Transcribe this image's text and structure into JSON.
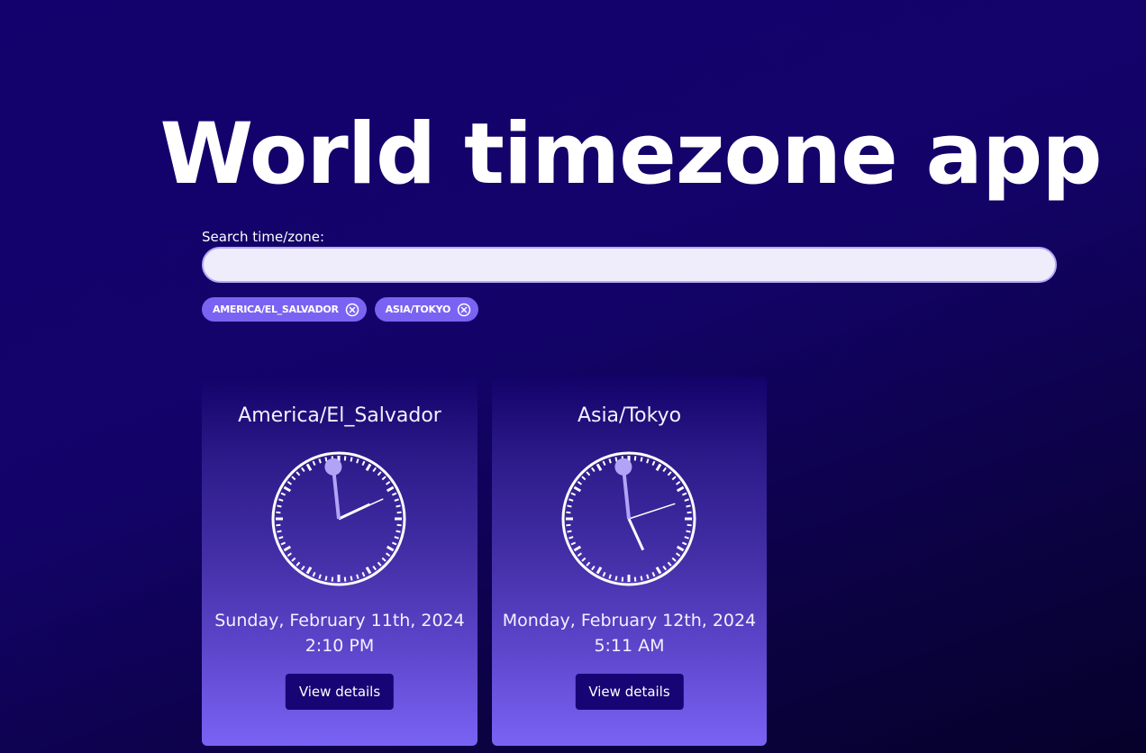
{
  "header": {
    "title": "World timezone app"
  },
  "search": {
    "label": "Search time/zone:",
    "value": "",
    "placeholder": ""
  },
  "chips": [
    {
      "label": "AMERICA/EL_SALVADOR",
      "remove_icon": "close-circle-icon"
    },
    {
      "label": "ASIA/TOKYO",
      "remove_icon": "close-circle-icon"
    }
  ],
  "cards": [
    {
      "zone": "America/El_Salvador",
      "date": "Sunday, February 11th, 2024",
      "time": "2:10 PM",
      "clock": {
        "hours": 14,
        "minutes": 10,
        "seconds": 59
      },
      "button_label": "View details"
    },
    {
      "zone": "Asia/Tokyo",
      "date": "Monday, February 12th, 2024",
      "time": "5:11 AM",
      "clock": {
        "hours": 5,
        "minutes": 11,
        "seconds": 59
      },
      "button_label": "View details"
    }
  ],
  "colors": {
    "accent": "#7a63f2",
    "button": "#170575",
    "clock_face": "#ffffff",
    "second_hand": "#b3a3f7"
  }
}
